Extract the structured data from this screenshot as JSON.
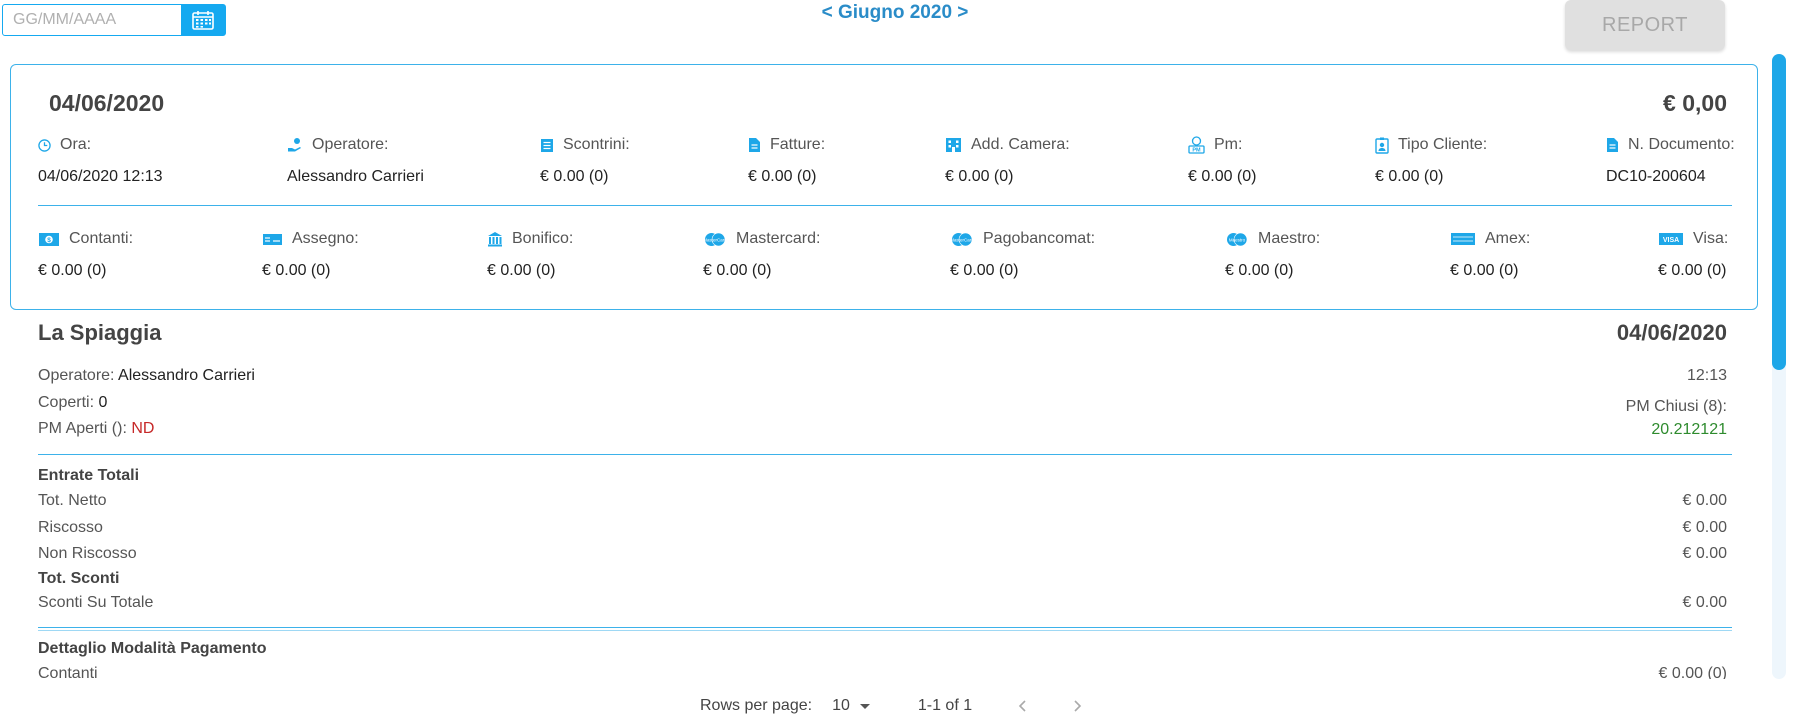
{
  "top": {
    "date_placeholder": "GG/MM/AAAA",
    "prev": "<",
    "month": "Giugno 2020",
    "next": ">",
    "report": "REPORT"
  },
  "summary": {
    "date": "04/06/2020",
    "total": "€ 0,00",
    "row1": [
      {
        "label": "Ora:",
        "value": "04/06/2020 12:13",
        "icon": "clock-icon"
      },
      {
        "label": "Operatore:",
        "value": "Alessandro Carrieri",
        "icon": "hand-coin-icon"
      },
      {
        "label": "Scontrini:",
        "value": "€ 0.00 (0)",
        "icon": "receipt-icon"
      },
      {
        "label": "Fatture:",
        "value": "€ 0.00 (0)",
        "icon": "invoice-icon"
      },
      {
        "label": "Add. Camera:",
        "value": "€ 0.00 (0)",
        "icon": "hotel-icon"
      },
      {
        "label": "Pm:",
        "value": "€ 0.00 (0)",
        "icon": "pm-icon"
      },
      {
        "label": "Tipo Cliente:",
        "value": "€ 0.00 (0)",
        "icon": "badge-icon"
      },
      {
        "label": "N. Documento:",
        "value": "DC10-200604",
        "icon": "document-icon"
      }
    ],
    "row2": [
      {
        "label": "Contanti:",
        "value": "€ 0.00 (0)",
        "icon": "cash-icon"
      },
      {
        "label": "Assegno:",
        "value": "€ 0.00 (0)",
        "icon": "check-icon"
      },
      {
        "label": "Bonifico:",
        "value": "€ 0.00 (0)",
        "icon": "bank-icon"
      },
      {
        "label": "Mastercard:",
        "value": "€ 0.00 (0)",
        "icon": "mastercard-icon"
      },
      {
        "label": "Pagobancomat:",
        "value": "€ 0.00 (0)",
        "icon": "pagobancomat-icon"
      },
      {
        "label": "Maestro:",
        "value": "€ 0.00 (0)",
        "icon": "maestro-icon"
      },
      {
        "label": "Amex:",
        "value": "€ 0.00 (0)",
        "icon": "amex-icon"
      },
      {
        "label": "Visa:",
        "value": "€ 0.00 (0)",
        "icon": "visa-icon"
      }
    ]
  },
  "detail": {
    "store": "La Spiaggia",
    "date": "04/06/2020",
    "operatore_label": "Operatore:",
    "operatore_value": "Alessandro Carrieri",
    "time": "12:13",
    "coperti_label": "Coperti:",
    "coperti_value": "0",
    "pm_chiusi": "PM Chiusi (8):",
    "pm_chiusi_value": "20.212121",
    "pm_aperti_label": "PM Aperti ():",
    "pm_aperti_value": "ND",
    "entrate_title": "Entrate Totali",
    "tot_netto": "Tot. Netto",
    "tot_netto_value": "€ 0.00",
    "riscosso": "Riscosso",
    "riscosso_value": "€ 0.00",
    "non_riscosso": "Non Riscosso",
    "non_riscosso_value": "€ 0.00",
    "sconti_title": "Tot. Sconti",
    "sconti_su_totale": "Sconti Su Totale",
    "sconti_su_totale_value": "€ 0.00",
    "pagamento_title": "Dettaglio Modalità Pagamento",
    "contanti": "Contanti",
    "contanti_value": "€ 0.00 (0)"
  },
  "footer": {
    "rows_per_page_label": "Rows per page:",
    "rows_per_page_value": "10",
    "range": "1-1 of 1"
  },
  "colors": {
    "accent": "#1ea7e8",
    "border": "#3db2ea",
    "negative": "#c62828",
    "positive": "#2e8b2e"
  }
}
